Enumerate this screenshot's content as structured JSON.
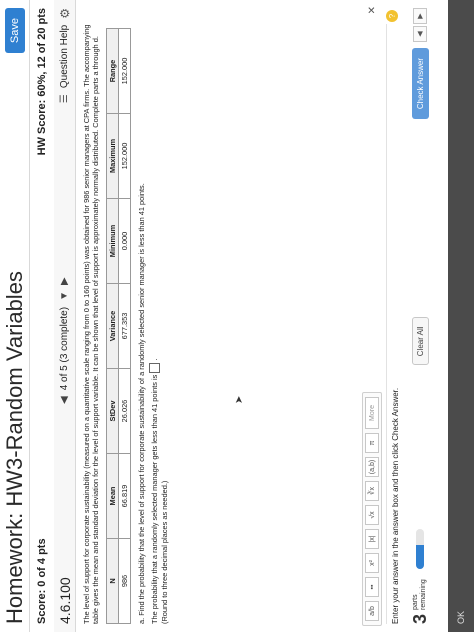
{
  "header": {
    "title": "Homework: HW3-Random Variables",
    "save_label": "Save"
  },
  "score": {
    "score_text": "Score: 0 of 4 pts",
    "hw_score_text": "HW Score: 60%, 12 of 20 pts"
  },
  "question_nav": {
    "number": "4.6.100",
    "position": "4 of 5 (3 complete)",
    "help_label": "Question Help",
    "prev_icon": "triangle-left-icon",
    "next_icon": "triangle-right-icon"
  },
  "problem": {
    "intro": "The level of support for corporate sustainability (measured on a quantitative scale ranging from 0 to 160 points) was obtained for 986 senior managers at CPA firms. The accompanying table gives the mean and standard deviation for the level of support variable. It can be shown that level of support is approximately normally distributed. Complete parts a through d.",
    "table": {
      "headers": [
        "N",
        "Mean",
        "StDev",
        "Variance",
        "Minimum",
        "Maximum",
        "Range"
      ],
      "row": [
        "986",
        "66.819",
        "26.026",
        "677.353",
        "0.000",
        "152.000",
        "152.000"
      ]
    },
    "part_a": "a. Find the probability that the level of support for corporate sustainability of a randomly selected senior manager is less than 41 points.",
    "answer_prompt": "The probability that a randomly selected manager gets less than 41 points is",
    "answer_note": "(Round to three decimal places as needed.)"
  },
  "toolbar": {
    "buttons": [
      {
        "label": "a/b",
        "icon": "fraction-icon"
      },
      {
        "label": "▪▪",
        "icon": "mixed-number-icon"
      },
      {
        "label": "x²",
        "icon": "exponent-icon"
      },
      {
        "label": "|x|",
        "icon": "absolute-value-icon"
      },
      {
        "label": "√x",
        "icon": "square-root-icon"
      },
      {
        "label": "∛x",
        "icon": "cube-root-icon"
      },
      {
        "label": "(a,b)",
        "icon": "interval-icon"
      },
      {
        "label": "π",
        "icon": "pi-icon"
      }
    ],
    "more_label": "More",
    "close_label": "✕"
  },
  "instruction": "Enter your answer in the answer box and then click Check Answer.",
  "footer": {
    "parts_number": "3",
    "parts_label_1": "parts",
    "parts_label_2": "remaining",
    "progress_fraction": 0.6,
    "clear_label": "Clear All",
    "check_label": "Check Answer"
  },
  "bottom_strip": {
    "text": "OK"
  },
  "colors": {
    "accent": "#2f80d1",
    "check_button": "#5f9bdc",
    "help_circle": "#f2c230"
  }
}
